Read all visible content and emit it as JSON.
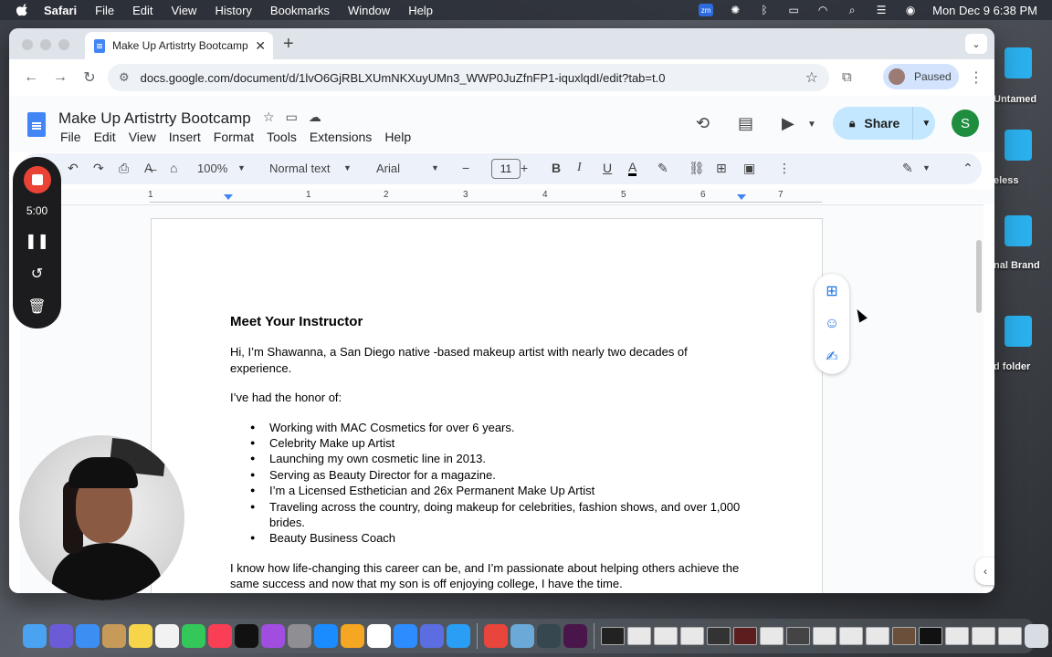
{
  "menubar": {
    "app": "Safari",
    "items": [
      "File",
      "Edit",
      "View",
      "History",
      "Bookmarks",
      "Window",
      "Help"
    ],
    "clock": "Mon Dec 9  6:38 PM",
    "zoom_badge": "zm"
  },
  "desktop": {
    "labels": [
      "Untamed",
      "eless",
      "nal Brand",
      "d folder"
    ]
  },
  "browser": {
    "tab_title": "Make Up Artistrty Bootcamp",
    "url": "docs.google.com/document/d/1lvO6GjRBLXUmNKXuyUMn3_WWP0JuZfnFP1-iquxlqdI/edit?tab=t.0",
    "profile_label": "Paused"
  },
  "docs": {
    "title": "Make Up Artistrty Bootcamp",
    "menu": [
      "File",
      "Edit",
      "View",
      "Insert",
      "Format",
      "Tools",
      "Extensions",
      "Help"
    ],
    "share_label": "Share",
    "avatar_letter": "S"
  },
  "toolbar": {
    "zoom": "100%",
    "style": "Normal text",
    "font": "Arial",
    "font_size": "11"
  },
  "ruler": {
    "numbers": [
      "1",
      "1",
      "2",
      "3",
      "4",
      "5",
      "6",
      "7"
    ]
  },
  "recorder": {
    "time": "5:00"
  },
  "document": {
    "heading": "Meet Your Instructor",
    "intro": "Hi, I’m Shawanna, a San Diego native -based makeup artist with nearly two decades of experience.",
    "honor": " I’ve had the honor of:",
    "bullets": [
      "Working with MAC Cosmetics for over 6 years.",
      "Celebrity Make up Artist",
      "Launching my own cosmetic line in 2013.",
      "Serving as Beauty Director for a magazine.",
      "I’m a Licensed Esthetician and 26x Permanent Make Up Artist",
      "Traveling across the country, doing makeup for celebrities, fashion shows, and over 1,000 brides.",
      "Beauty Business Coach"
    ],
    "closing": "I know how life-changing this career can be, and I’m passionate about helping others achieve the same success and now that my son is off enjoying college, I have the time."
  },
  "colors": {
    "share_bg": "#c2e7ff",
    "toolbar_bg": "#edf2fa",
    "record_red": "#ea4335",
    "avatar_green": "#1e8e3e",
    "docs_blue": "#4285f4"
  }
}
